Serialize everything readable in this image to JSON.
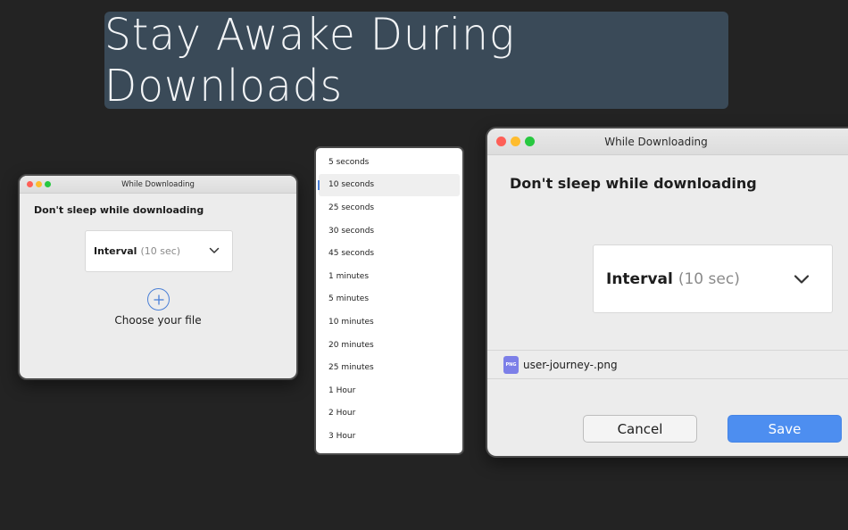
{
  "banner": {
    "title": "Stay Awake During Downloads"
  },
  "small_window": {
    "title": "While Downloading",
    "heading": "Don't sleep while downloading",
    "select": {
      "label": "Interval",
      "value": "(10 sec)"
    },
    "choose_label": "Choose your file",
    "icons": {
      "add": "plus-circle-icon",
      "chevron": "chevron-down-icon"
    }
  },
  "dropdown": {
    "selected_index": 1,
    "options": [
      "5 seconds",
      "10 seconds",
      "25 seconds",
      "30 seconds",
      "45 seconds",
      "1 minutes",
      "5 minutes",
      "10 minutes",
      "20 minutes",
      "25 minutes",
      "1 Hour",
      "2 Hour",
      "3 Hour"
    ]
  },
  "large_window": {
    "title": "While Downloading",
    "heading": "Don't sleep while downloading",
    "select": {
      "label": "Interval",
      "value": "(10 sec)"
    },
    "file": {
      "badge": "PNG",
      "name": "user-journey-.png"
    },
    "buttons": {
      "cancel": "Cancel",
      "save": "Save"
    }
  },
  "colors": {
    "background": "#232323",
    "banner": "#3a4a58",
    "accent": "#4d8ef0",
    "file_icon": "#7c7fe8"
  }
}
